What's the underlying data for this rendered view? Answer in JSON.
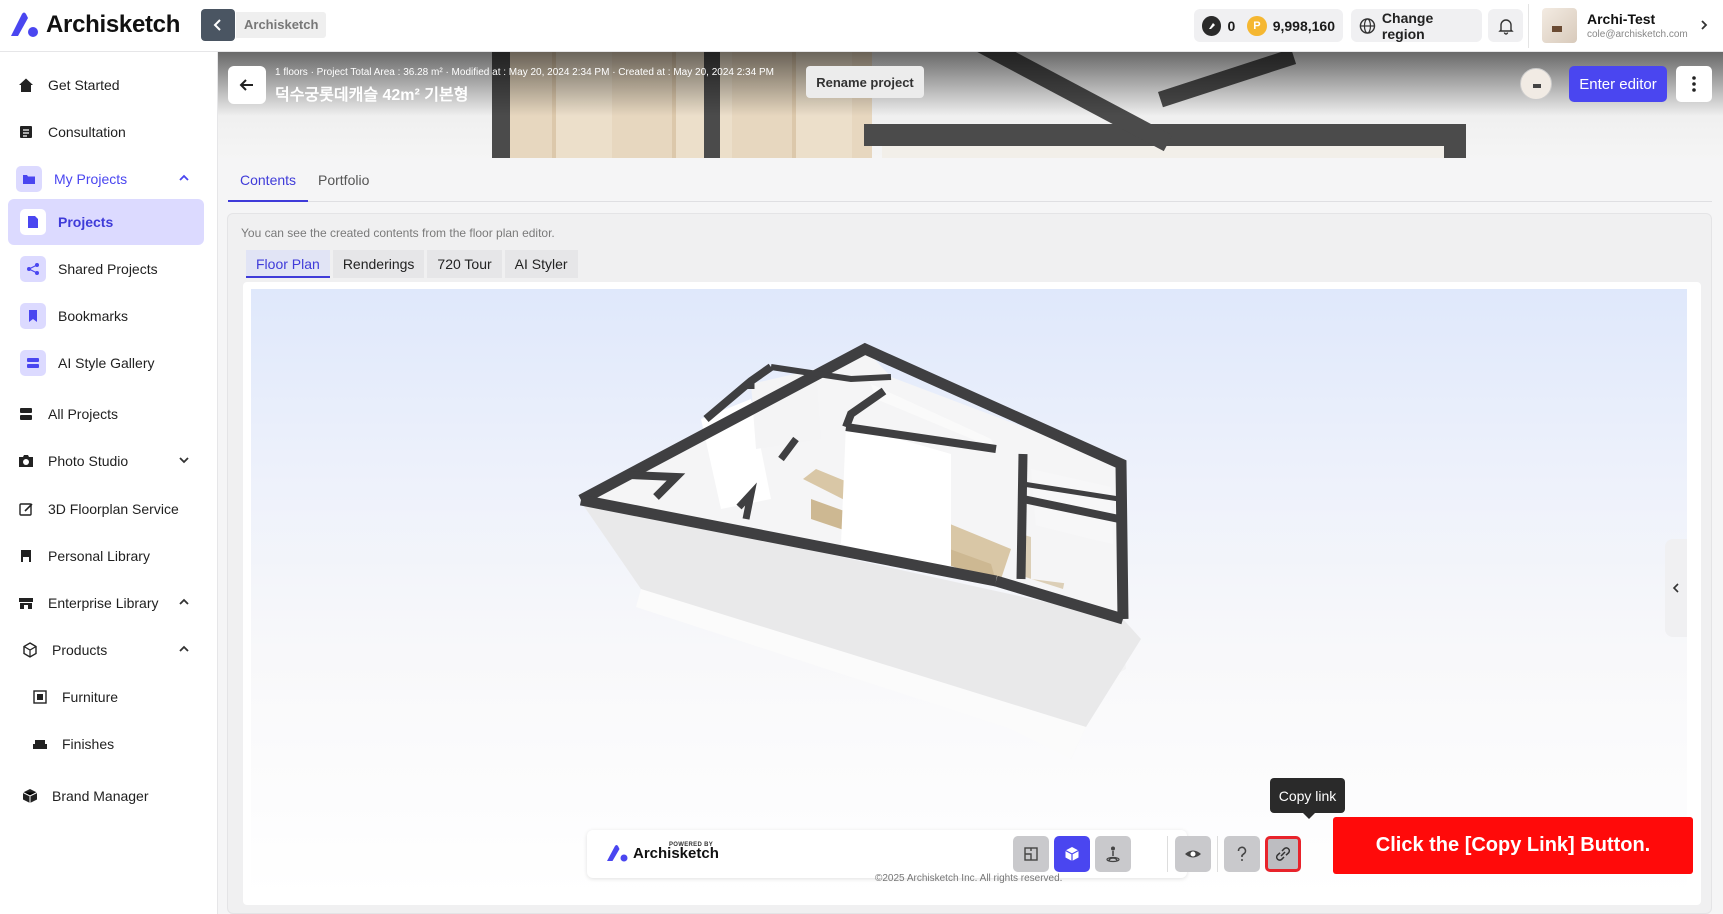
{
  "app": {
    "brand": "Archisketch"
  },
  "topbar": {
    "breadcrumb": "Archisketch",
    "credit_a": "0",
    "credit_b_symbol": "P",
    "credit_b": "9,998,160",
    "region_label": "Change region",
    "user_name": "Archi-Test",
    "user_email": "cole@archisketch.com"
  },
  "sidebar": {
    "items": [
      {
        "label": "Get Started",
        "icon": "home-icon"
      },
      {
        "label": "Consultation",
        "icon": "document-icon"
      },
      {
        "label": "My Projects",
        "icon": "folder-icon"
      },
      {
        "label": "Projects",
        "icon": "file-icon"
      },
      {
        "label": "Shared Projects",
        "icon": "share-icon"
      },
      {
        "label": "Bookmarks",
        "icon": "bookmark-icon"
      },
      {
        "label": "AI Style Gallery",
        "icon": "gallery-icon"
      },
      {
        "label": "All Projects",
        "icon": "server-icon"
      },
      {
        "label": "Photo Studio",
        "icon": "camera-icon"
      },
      {
        "label": "3D Floorplan Service",
        "icon": "edit-icon"
      },
      {
        "label": "Personal Library",
        "icon": "book-icon"
      },
      {
        "label": "Enterprise Library",
        "icon": "store-icon"
      },
      {
        "label": "Products",
        "icon": "cube-icon"
      },
      {
        "label": "Furniture",
        "icon": "furniture-icon"
      },
      {
        "label": "Finishes",
        "icon": "sofa-icon"
      },
      {
        "label": "Brand Manager",
        "icon": "box-icon"
      }
    ]
  },
  "project": {
    "meta": "1 floors · Project Total Area : 36.28 m² · Modified at : May 20, 2024 2:34 PM · Created at : May 20, 2024 2:34 PM",
    "title": "덕수궁롯데캐슬 42m² 기본형",
    "rename_label": "Rename project",
    "enter_editor_label": "Enter editor"
  },
  "tabs": [
    "Contents",
    "Portfolio"
  ],
  "contents": {
    "hint": "You can see the created contents from the floor plan editor.",
    "subtabs": [
      "Floor Plan",
      "Renderings",
      "720 Tour",
      "AI Styler"
    ]
  },
  "viewer": {
    "powered_by": "POWERED BY",
    "powered_brand": "Archisketch",
    "tooltip": "Copy link",
    "copyright": "©2025 Archisketch Inc. All rights reserved."
  },
  "callout": "Click the [Copy Link] Button.",
  "colors": {
    "accent": "#4a46f0",
    "callout": "#ff0a0a"
  }
}
